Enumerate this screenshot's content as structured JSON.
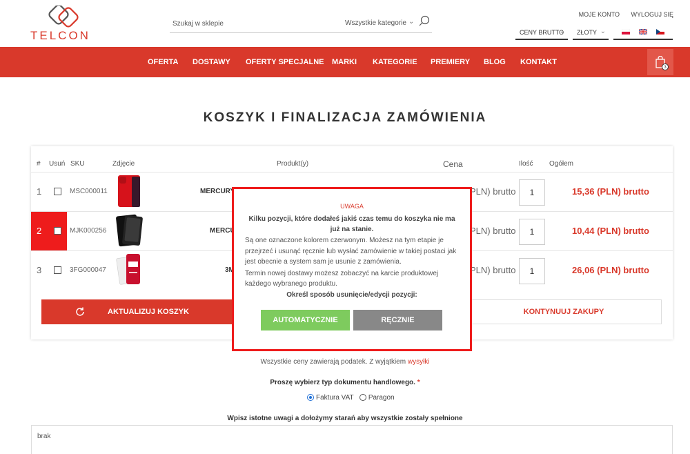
{
  "brand": {
    "logo_text": "TELCON",
    "accent": "#d9392b"
  },
  "search": {
    "placeholder": "Szukaj w sklepie",
    "category": "Wszystkie kategorie"
  },
  "toplinks": {
    "account": "MOJE KONTO",
    "logout": "WYLOGUJ SIĘ"
  },
  "selects": {
    "price_mode": "CENY BRUTTO",
    "currency": "ZŁOTY"
  },
  "nav": {
    "items": [
      "OFERTA",
      "DOSTAWY",
      "OFERTY SPECJALNE",
      "MARKI",
      "KATEGORIE",
      "PREMIERY",
      "BLOG",
      "KONTAKT"
    ],
    "cart_count": "3"
  },
  "page": {
    "title": "KOSZYK I FINALIZACJA ZAMÓWIENIA"
  },
  "table": {
    "headers": {
      "num": "#",
      "remove": "Usuń",
      "sku": "SKU",
      "image": "Zdjęcie",
      "product": "Produkt(y)",
      "price": "Cena",
      "qty": "Ilość",
      "total": "Ogółem"
    },
    "rows": [
      {
        "num": "1",
        "sku": "MSC000011",
        "product": "MERCURY",
        "price": "PLN) brutto",
        "qty": "1",
        "total": "15,36 (PLN) brutto",
        "unavailable": false
      },
      {
        "num": "2",
        "sku": "MJK000256",
        "product": "MERCU",
        "price": "PLN) brutto",
        "qty": "1",
        "total": "10,44 (PLN) brutto",
        "unavailable": true
      },
      {
        "num": "3",
        "sku": "3FG000047",
        "product": "3M",
        "price": "PLN) brutto",
        "qty": "1",
        "total": "26,06 (PLN) brutto",
        "unavailable": false
      }
    ],
    "update_label": "AKTUALIZUJ KOSZYK",
    "continue_label": "KONTYNUUJ ZAKUPY"
  },
  "modal": {
    "title": "UWAGA",
    "bold_text": "Kilku pozycji, które dodałeś jakiś czas temu do koszyka nie ma już na stanie.",
    "text1": "Są one oznaczone kolorem czerwonym. Możesz na tym etapie je przejrzeć i usunąć ręcznie lub wysłać zamówienie w takiej postaci jak jest obecnie a system sam je usunie z zamówienia.",
    "text2": "Termin nowej dostawy możesz zobaczyć na karcie produktowej każdego wybranego produktu.",
    "question": "Określ sposób usunięcie/edycji pozycji:",
    "auto_label": "AUTOMATYCZNIE",
    "manual_label": "RĘCZNIE"
  },
  "footer": {
    "tax_note": "Wszystkie ceny zawierają podatek. Z wyjątkiem",
    "tax_link": "wysyłki",
    "doc_type_label": "Proszę wybierz typ dokumentu handlowego.",
    "required_mark": "*",
    "option_invoice": "Faktura VAT",
    "option_receipt": "Paragon",
    "notes_label": "Wpisz istotne uwagi a dołożymy starań aby wszystkie zostały spełnione",
    "notes_value": "brak"
  }
}
